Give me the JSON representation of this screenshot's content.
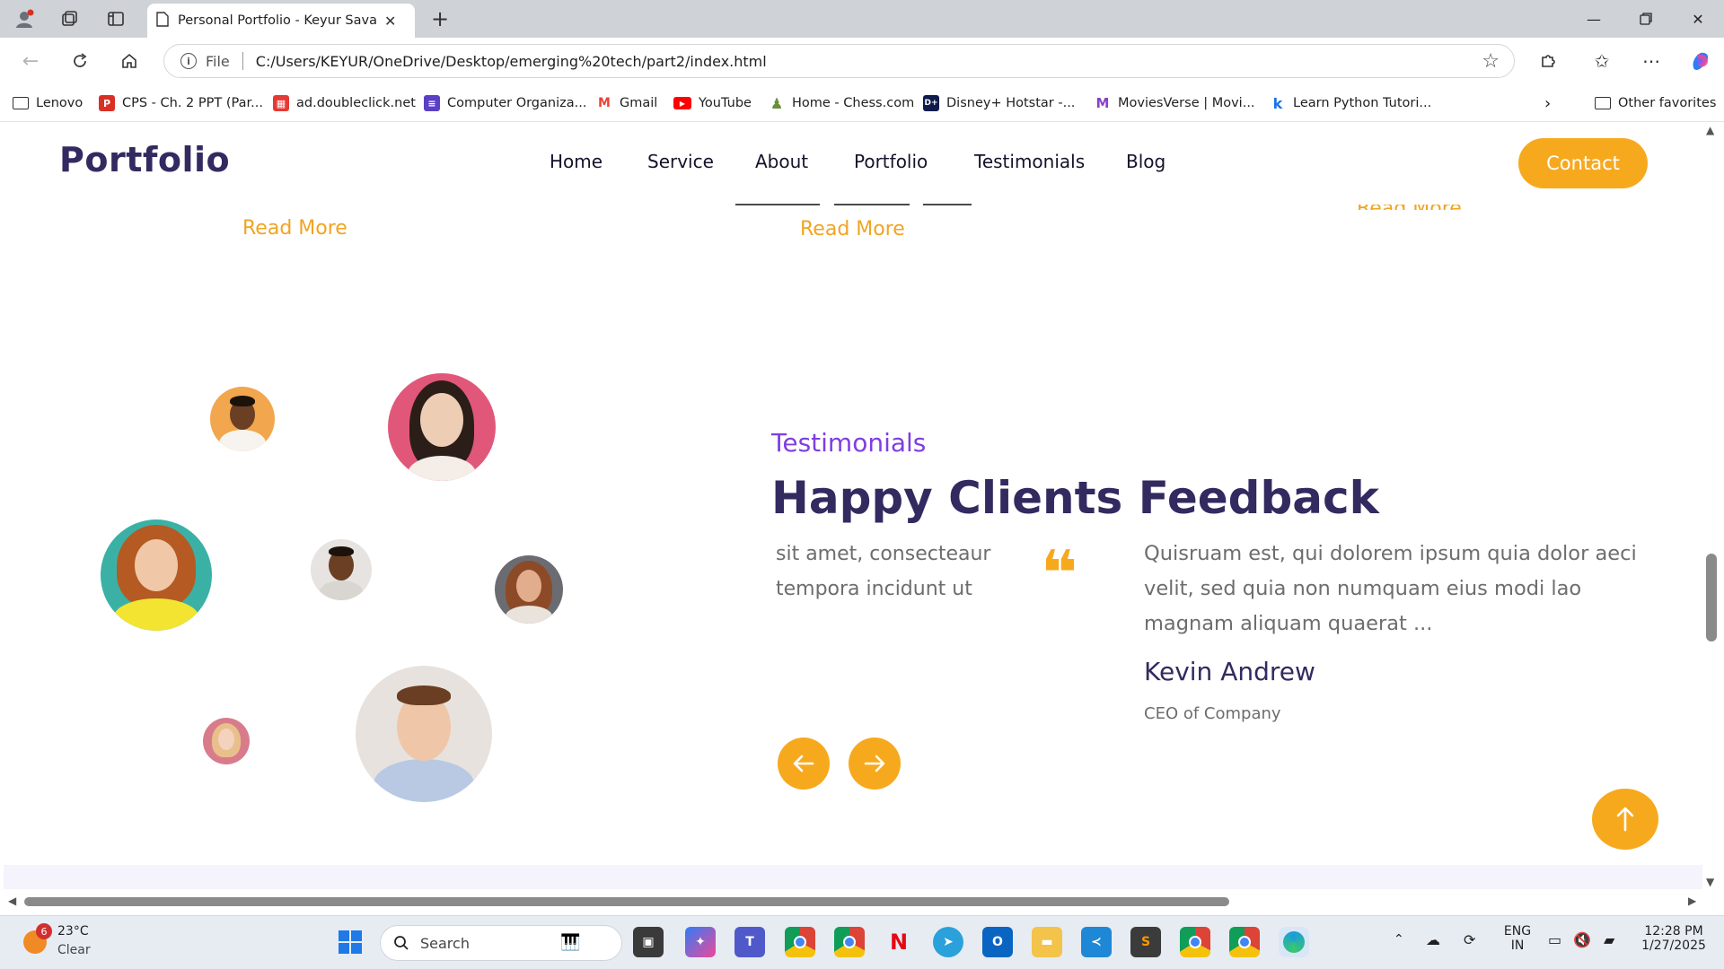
{
  "browser": {
    "tab_title": "Personal Portfolio - Keyur Savaliya",
    "new_tab_icon": "+",
    "url_scheme": "File",
    "url": "C:/Users/KEYUR/OneDrive/Desktop/emerging%20tech/part2/index.html",
    "bookmarks": [
      {
        "label": "Lenovo",
        "icon": "folder-icon"
      },
      {
        "label": "CPS - Ch. 2 PPT (Par...",
        "icon": "pdf-icon",
        "color": "#d93025"
      },
      {
        "label": "ad.doubleclick.net",
        "icon": "doubleclick-icon",
        "color": "#e53935"
      },
      {
        "label": "Computer Organiza...",
        "icon": "doc-icon",
        "color": "#5b3fc4"
      },
      {
        "label": "Gmail",
        "icon": "gmail-icon",
        "color": "#ea4335"
      },
      {
        "label": "YouTube",
        "icon": "youtube-icon",
        "color": "#ff0000"
      },
      {
        "label": "Home - Chess.com",
        "icon": "chess-icon",
        "color": "#6b8f3b"
      },
      {
        "label": "Disney+ Hotstar -...",
        "icon": "hotstar-icon",
        "color": "#0f1b4c"
      },
      {
        "label": "MoviesVerse | Movi...",
        "icon": "moviesverse-icon",
        "color": "#8b3fc4"
      },
      {
        "label": "Learn Python Tutori...",
        "icon": "k-icon",
        "color": "#1a73e8"
      }
    ],
    "other_favorites": "Other favorites"
  },
  "site": {
    "logo": "Portfolio",
    "nav": [
      "Home",
      "Service",
      "About",
      "Portfolio",
      "Testimonials",
      "Blog"
    ],
    "contact": "Contact",
    "read_more": "Read More",
    "testimonials": {
      "eyebrow": "Testimonials",
      "heading": "Happy Clients Feedback",
      "prev_quote_fragment": "sit amet, consecteaur tempora incidunt ut",
      "quote": "Quisruam est, qui dolorem ipsum quia dolor aeci velit, sed quia non numquam eius modi lao magnam aliquam quaerat ...",
      "name": "Kevin Andrew",
      "role": "CEO of Company"
    },
    "accent_color": "#f7a91e",
    "heading_color": "#332a60",
    "eyebrow_color": "#7f3ee0"
  },
  "taskbar": {
    "weather_badge": "6",
    "temperature": "23°C",
    "condition": "Clear",
    "search": "Search",
    "lang_primary": "ENG",
    "lang_secondary": "IN",
    "time": "12:28 PM",
    "date": "1/27/2025"
  }
}
